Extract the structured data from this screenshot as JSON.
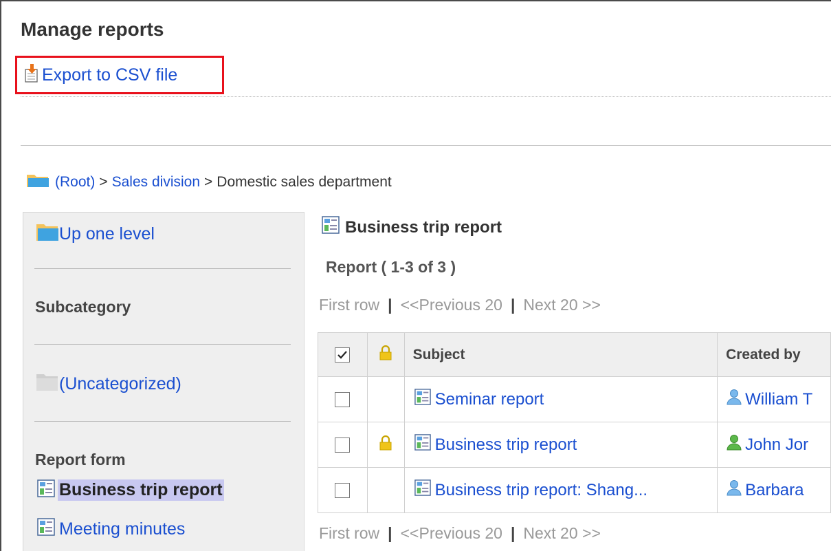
{
  "page": {
    "title": "Manage reports"
  },
  "toolbar": {
    "export_label": "Export to CSV file"
  },
  "breadcrumb": {
    "root": "(Root)",
    "separator": ">",
    "level1": "Sales division",
    "current": "Domestic sales department"
  },
  "sidebar": {
    "up_label": "Up one level",
    "subcategory_heading": "Subcategory",
    "uncategorized_label": "(Uncategorized)",
    "report_form_heading": "Report form",
    "forms": [
      "Business trip report",
      "Meeting minutes"
    ]
  },
  "main": {
    "title": "Business trip report",
    "count_label": "Report ( 1-3 of 3 )",
    "pager": {
      "first": "First row",
      "prev": "<<Previous 20",
      "next": "Next 20 >>",
      "divider": "|"
    }
  },
  "table": {
    "headers": {
      "subject": "Subject",
      "created_by": "Created by"
    },
    "rows": [
      {
        "subject": "Seminar report",
        "author": "William T",
        "locked": false,
        "author_color": "blue"
      },
      {
        "subject": "Business trip report",
        "author": "John Jor",
        "locked": true,
        "author_color": "green"
      },
      {
        "subject": "Business trip report: Shang...",
        "author": "Barbara",
        "locked": false,
        "author_color": "blue"
      }
    ]
  },
  "colors": {
    "link": "#1a4fd0",
    "highlight": "#e8101b",
    "selected_bg": "#c8c8f0",
    "sidebar_bg": "#efefef"
  }
}
